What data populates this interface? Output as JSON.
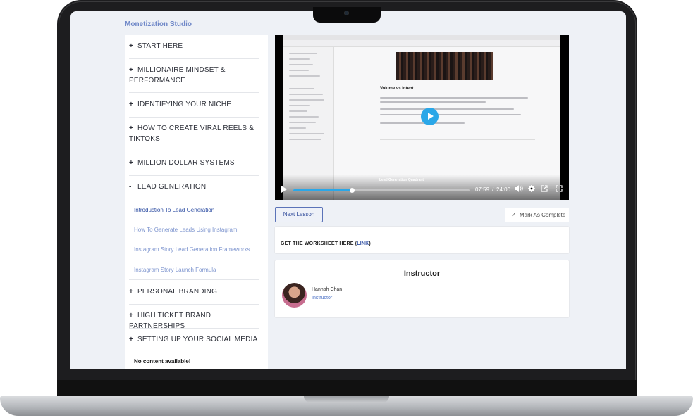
{
  "brand": {
    "name": "Monetization Studio"
  },
  "sidebar": {
    "modules": [
      {
        "icon": "+",
        "label": "START HERE"
      },
      {
        "icon": "+",
        "label": "MILLIONAIRE MINDSET & PERFORMANCE"
      },
      {
        "icon": "+",
        "label": "IDENTIFYING YOUR NICHE"
      },
      {
        "icon": "+",
        "label": "HOW TO CREATE VIRAL REELS & TIKTOKS"
      },
      {
        "icon": "+",
        "label": "MILLION DOLLAR SYSTEMS"
      },
      {
        "icon": "-",
        "label": "LEAD GENERATION"
      },
      {
        "icon": "+",
        "label": "PERSONAL BRANDING"
      },
      {
        "icon": "+",
        "label": "HIGH TICKET BRAND PARTNERSHIPS"
      },
      {
        "icon": "+",
        "label": "SETTING UP YOUR SOCIAL MEDIA"
      }
    ],
    "lessons": [
      {
        "label": "Introduction To Lead Generation",
        "active": true
      },
      {
        "label": "How To Generate Leads Using Instagram",
        "active": false
      },
      {
        "label": "Instagram Story Lead Generation Frameworks",
        "active": false
      },
      {
        "label": "Instagram Story Launch Formula",
        "active": false
      }
    ],
    "empty_text": "No content available!"
  },
  "video": {
    "doc_heading": "Volume vs Intent",
    "overlay_title": "Lead Generation Quadrant",
    "current_time": "07:59",
    "separator": "/",
    "duration": "24:00",
    "progress_fraction": 0.333,
    "accent": "#2aa7e8",
    "icons": [
      "play-icon",
      "volume-icon",
      "settings-icon",
      "popout-icon",
      "fullscreen-icon"
    ]
  },
  "actions": {
    "next_label": "Next Lesson",
    "complete_label": "Mark As Complete",
    "complete_icon": "check-icon"
  },
  "worksheet": {
    "text_before": "GET THE WORKSHEET HERE (",
    "link_text": "LINK",
    "text_after": ")"
  },
  "instructor": {
    "title": "Instructor",
    "name": "Hannah Chan",
    "role": "Instructor"
  }
}
